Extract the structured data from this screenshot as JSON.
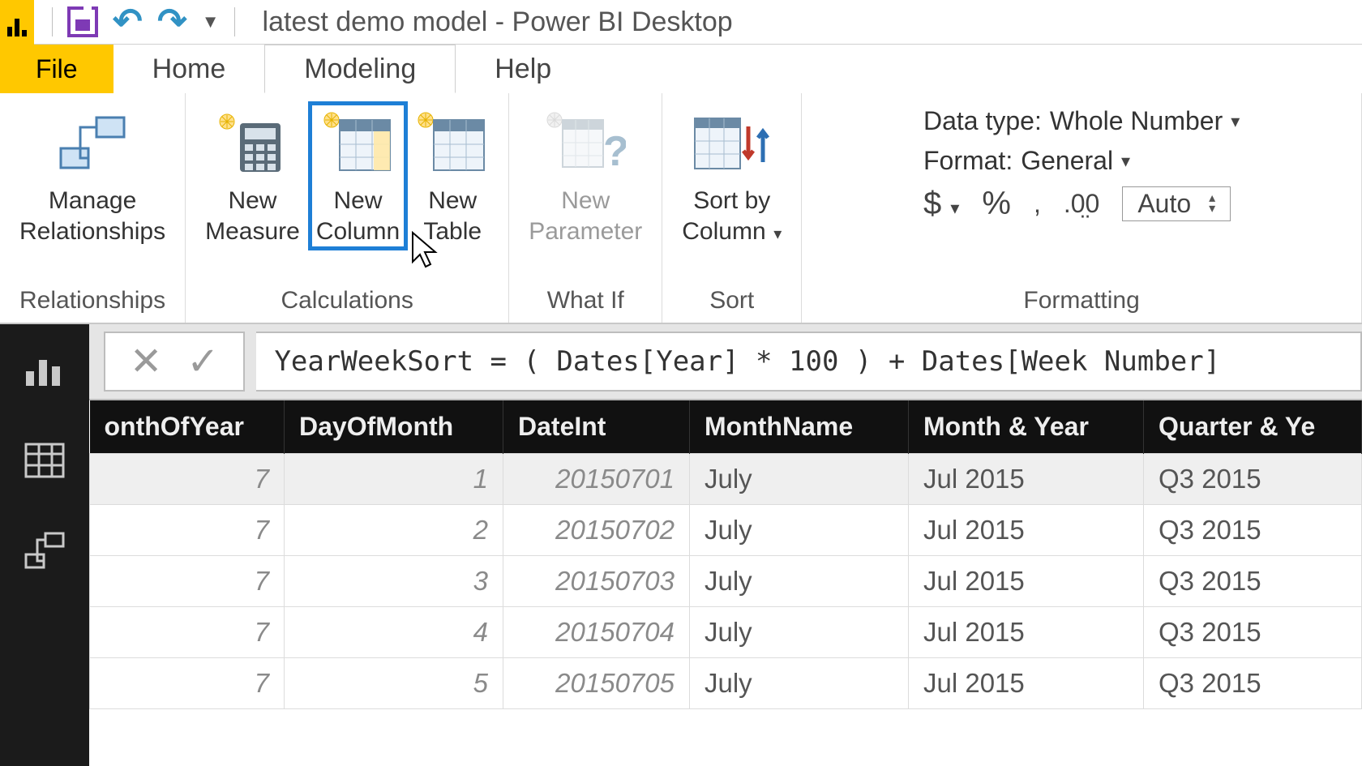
{
  "title": "latest demo model - Power BI Desktop",
  "tabs": {
    "file": "File",
    "home": "Home",
    "modeling": "Modeling",
    "help": "Help"
  },
  "ribbon": {
    "relationships": {
      "manage": "Manage\nRelationships",
      "group": "Relationships"
    },
    "calculations": {
      "measure": "New\nMeasure",
      "column": "New\nColumn",
      "table": "New\nTable",
      "group": "Calculations"
    },
    "whatif": {
      "parameter": "New\nParameter",
      "group": "What If"
    },
    "sort": {
      "sortby": "Sort by\nColumn",
      "group": "Sort"
    },
    "formatting": {
      "datatype_lbl": "Data type:",
      "datatype_val": "Whole Number",
      "format_lbl": "Format:",
      "format_val": "General",
      "auto": "Auto",
      "group": "Formatting"
    }
  },
  "formula": "YearWeekSort = ( Dates[Year] * 100 ) + Dates[Week Number]",
  "columns": [
    "onthOfYear",
    "DayOfMonth",
    "DateInt",
    "MonthName",
    "Month & Year",
    "Quarter & Ye"
  ],
  "rows": [
    {
      "m": "7",
      "d": "1",
      "di": "20150701",
      "mn": "July",
      "my": "Jul 2015",
      "qy": "Q3 2015"
    },
    {
      "m": "7",
      "d": "2",
      "di": "20150702",
      "mn": "July",
      "my": "Jul 2015",
      "qy": "Q3 2015"
    },
    {
      "m": "7",
      "d": "3",
      "di": "20150703",
      "mn": "July",
      "my": "Jul 2015",
      "qy": "Q3 2015"
    },
    {
      "m": "7",
      "d": "4",
      "di": "20150704",
      "mn": "July",
      "my": "Jul 2015",
      "qy": "Q3 2015"
    },
    {
      "m": "7",
      "d": "5",
      "di": "20150705",
      "mn": "July",
      "my": "Jul 2015",
      "qy": "Q3 2015"
    }
  ]
}
